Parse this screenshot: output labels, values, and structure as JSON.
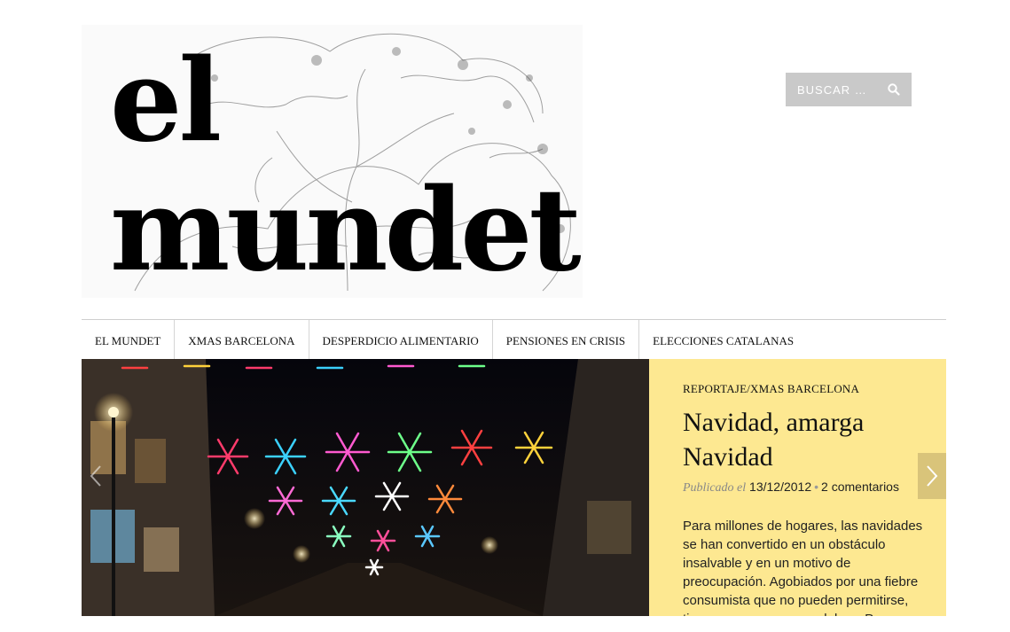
{
  "site": {
    "logo_line1": "el",
    "logo_line2": "mundet"
  },
  "search": {
    "placeholder": "BUSCAR …",
    "button_icon": "search-icon"
  },
  "nav": {
    "items": [
      {
        "label": "EL MUNDET"
      },
      {
        "label": "XMAS BARCELONA"
      },
      {
        "label": "DESPERDICIO ALIMENTARIO"
      },
      {
        "label": "PENSIONES EN CRISIS"
      },
      {
        "label": "ELECCIONES CATALANAS"
      }
    ]
  },
  "slide": {
    "categories": [
      "REPORTAJE",
      "XMAS BARCELONA"
    ],
    "category_separator": "/",
    "title": "Navidad, amarga Navidad",
    "published_label": "Publicado el",
    "date": "13/12/2012",
    "comments": "2 comentarios",
    "meta_separator": "•",
    "excerpt": "Para millones de hogares, las navidades se han convertido en un obstáculo insalvable y en un motivo de preocupación. Agobiados por una fiebre consumista que no pueden permitirse, tienen muy poco que celebrar. Pese a",
    "prev_icon": "chevron-left-icon",
    "next_icon": "chevron-right-icon"
  },
  "colors": {
    "panel_bg": "#fde891",
    "search_bg": "#c9c9c9",
    "next_arrow_bg": "#d9c47a"
  }
}
